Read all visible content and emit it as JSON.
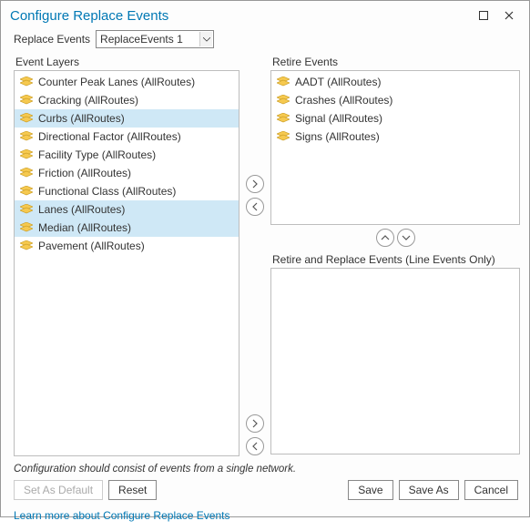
{
  "window": {
    "title": "Configure Replace Events"
  },
  "dropdown": {
    "label": "Replace Events",
    "selected": "ReplaceEvents 1"
  },
  "labels": {
    "event_layers": "Event Layers",
    "retire_events": "Retire Events",
    "retire_replace": "Retire and Replace Events (Line Events Only)"
  },
  "event_layers": [
    {
      "label": "Counter Peak Lanes (AllRoutes)",
      "selected": false
    },
    {
      "label": "Cracking (AllRoutes)",
      "selected": false
    },
    {
      "label": "Curbs (AllRoutes)",
      "selected": true
    },
    {
      "label": "Directional Factor (AllRoutes)",
      "selected": false
    },
    {
      "label": "Facility Type (AllRoutes)",
      "selected": false
    },
    {
      "label": "Friction (AllRoutes)",
      "selected": false
    },
    {
      "label": "Functional Class (AllRoutes)",
      "selected": false
    },
    {
      "label": "Lanes (AllRoutes)",
      "selected": true
    },
    {
      "label": "Median (AllRoutes)",
      "selected": true
    },
    {
      "label": "Pavement (AllRoutes)",
      "selected": false
    }
  ],
  "retire_events": [
    {
      "label": "AADT (AllRoutes)"
    },
    {
      "label": "Crashes (AllRoutes)"
    },
    {
      "label": "Signal (AllRoutes)"
    },
    {
      "label": "Signs (AllRoutes)"
    }
  ],
  "retire_replace_events": [],
  "hint": "Configuration should consist of events from a single network.",
  "buttons": {
    "set_default": "Set As Default",
    "reset": "Reset",
    "save": "Save",
    "save_as": "Save As",
    "cancel": "Cancel"
  },
  "link": "Learn more about Configure Replace Events",
  "icons": {
    "event_layer": "event-layer-icon"
  }
}
